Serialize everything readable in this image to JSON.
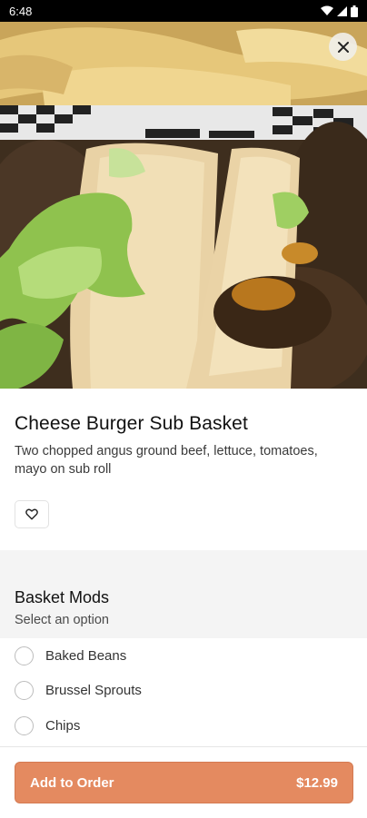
{
  "status_bar": {
    "time": "6:48"
  },
  "item": {
    "title": "Cheese Burger Sub Basket",
    "description": "Two chopped angus ground beef, lettuce, tomatoes, mayo on sub roll"
  },
  "mods": {
    "title": "Basket Mods",
    "subtitle": "Select an option",
    "options": [
      {
        "label": "Baked Beans"
      },
      {
        "label": "Brussel Sprouts"
      },
      {
        "label": "Chips"
      }
    ]
  },
  "order": {
    "button_label": "Add to Order",
    "price": "$12.99"
  },
  "icons": {
    "close": "close-icon",
    "favorite": "heart-outline-icon",
    "wifi": "wifi-icon",
    "signal": "signal-icon",
    "battery": "battery-icon"
  },
  "colors": {
    "accent": "#e48a60",
    "status_bar": "#000000"
  }
}
